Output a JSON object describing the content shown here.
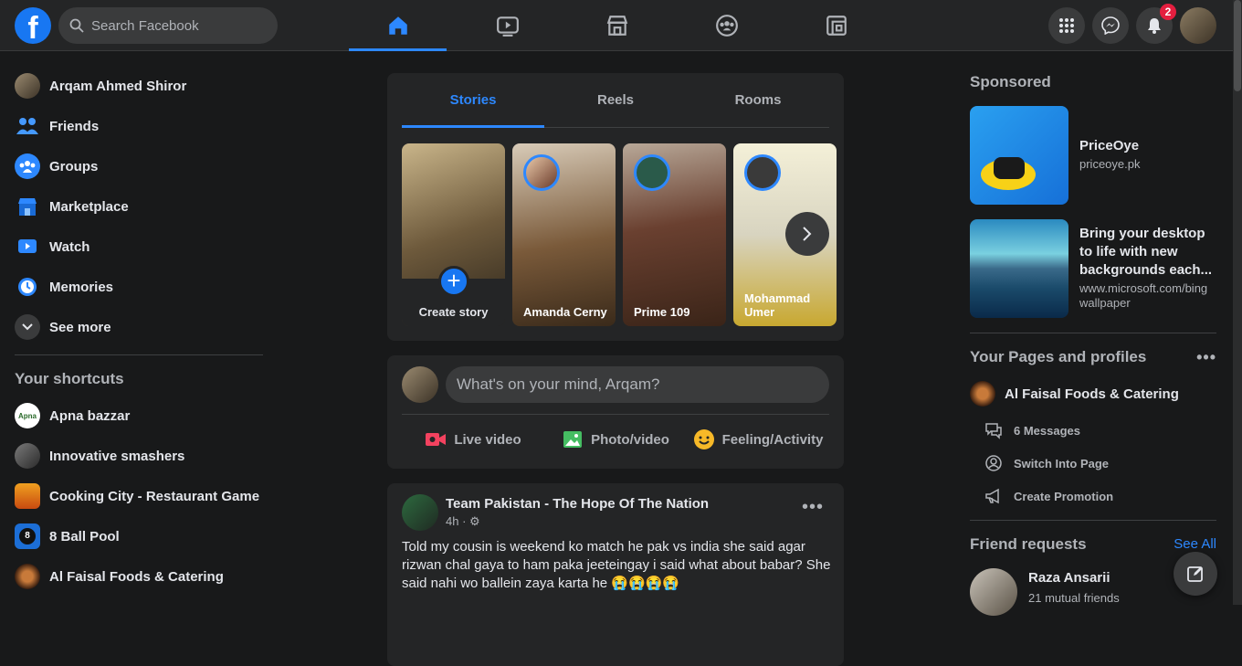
{
  "header": {
    "logo": "f",
    "search_placeholder": "Search Facebook",
    "notifications_count": "2",
    "nav_tabs": [
      "home-icon",
      "watch-icon",
      "marketplace-icon",
      "groups-icon",
      "gaming-icon"
    ]
  },
  "left_nav": {
    "profile_name": "Arqam Ahmed Shiror",
    "items": [
      "Friends",
      "Groups",
      "Marketplace",
      "Watch",
      "Memories",
      "See more"
    ],
    "shortcuts_title": "Your shortcuts",
    "shortcuts": [
      "Apna bazzar",
      "Innovative smashers",
      "Cooking City - Restaurant Game",
      "8 Ball Pool",
      "Al Faisal Foods & Catering"
    ]
  },
  "stories": {
    "tabs": [
      "Stories",
      "Reels",
      "Rooms"
    ],
    "create_label": "Create story",
    "items": [
      "Amanda Cerny",
      "Prime 109",
      "Mohammad Umer"
    ]
  },
  "composer": {
    "placeholder": "What's on your mind, Arqam?",
    "actions": [
      "Live video",
      "Photo/video",
      "Feeling/Activity"
    ]
  },
  "post": {
    "author": "Team Pakistan - The Hope Of The Nation",
    "time": "4h ·",
    "text": "Told my cousin is weekend ko match he pak vs india she said agar rizwan chal gaya to ham paka jeeteingay i said what about babar? She said nahi wo ballein zaya karta he 😭😭😭😭"
  },
  "sidebar_right": {
    "sponsored_title": "Sponsored",
    "ads": [
      {
        "title": "PriceOye",
        "url": "priceoye.pk"
      },
      {
        "title": "Bring your desktop to life with new backgrounds each...",
        "url": "www.microsoft.com/bing wallpaper"
      }
    ],
    "pages_title": "Your Pages and profiles",
    "page_name": "Al Faisal Foods & Catering",
    "page_actions": [
      "6 Messages",
      "Switch Into Page",
      "Create Promotion"
    ],
    "friend_requests_title": "Friend requests",
    "see_all": "See All",
    "request_name": "Raza Ansarii",
    "mutual": "21 mutual friends"
  }
}
